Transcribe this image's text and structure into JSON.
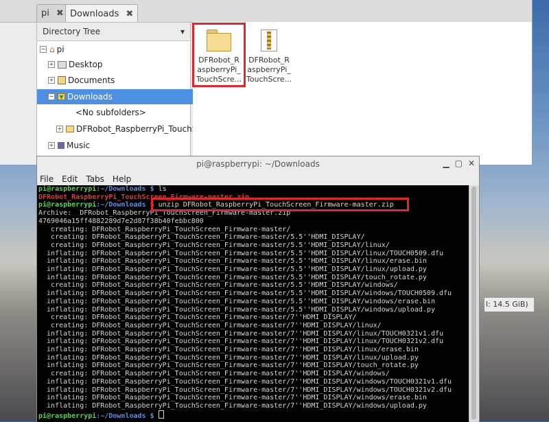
{
  "file_manager": {
    "tabs": [
      {
        "label": "pi",
        "close": "✖"
      },
      {
        "label": "Downloads",
        "close": "✖"
      }
    ],
    "tree_header": "Directory Tree",
    "tree_items": [
      {
        "label": "pi",
        "expander": ""
      },
      {
        "label": "Desktop",
        "expander": "+"
      },
      {
        "label": "Documents",
        "expander": "+"
      },
      {
        "label": "Downloads",
        "expander": "−"
      },
      {
        "label": "<No subfolders>",
        "expander": ""
      },
      {
        "label": "DFRobot_RaspberryPi_TouchSc",
        "expander": "+"
      },
      {
        "label": "Music",
        "expander": "+"
      }
    ],
    "files": [
      {
        "name": "DFRobot_RaspberryPi_TouchScre...",
        "line1": "DFRobot_R",
        "line2": "aspberryPi_",
        "line3": "TouchScre...",
        "icon": "folder-icon"
      },
      {
        "name": "DFRobot_RaspberryPi_TouchScre...",
        "line1": "DFRobot_R",
        "line2": "aspberryPi_",
        "line3": "TouchScre...",
        "icon": "zip-archive-icon"
      }
    ],
    "status_free": "l: 14.5 GiB)"
  },
  "terminal": {
    "title": "pi@raspberrypi: ~/Downloads",
    "menu": [
      "File",
      "Edit",
      "Tabs",
      "Help"
    ],
    "prompt_user": "pi@raspberrypi",
    "prompt_path": ":~/Downloads $",
    "cmd1": " ls",
    "ls_output": "DFRobot_RaspberryPi_TouchScreen_Firmware-master.zip",
    "cmd2": " unzip DFRobot_RaspberryPi_TouchScreen_Firmware-master.zip",
    "archive_line": "Archive:  DFRobot_RaspberryPi_TouchScreen_Firmware-master.zip",
    "hash_line": "4769046a15ff4882289d7e2d87f38b40febbc800",
    "output": [
      "   creating: DFRobot_RaspberryPi_TouchScreen_Firmware-master/",
      "   creating: DFRobot_RaspberryPi_TouchScreen_Firmware-master/5.5''HDMI_DISPLAY/",
      "   creating: DFRobot_RaspberryPi_TouchScreen_Firmware-master/5.5''HDMI_DISPLAY/linux/",
      "  inflating: DFRobot_RaspberryPi_TouchScreen_Firmware-master/5.5''HDMI_DISPLAY/linux/TOUCH0509.dfu",
      "  inflating: DFRobot_RaspberryPi_TouchScreen_Firmware-master/5.5''HDMI_DISPLAY/linux/erase.bin",
      "  inflating: DFRobot_RaspberryPi_TouchScreen_Firmware-master/5.5''HDMI_DISPLAY/linux/upload.py",
      "  inflating: DFRobot_RaspberryPi_TouchScreen_Firmware-master/5.5''HDMI_DISPLAY/touch_rotate.py",
      "   creating: DFRobot_RaspberryPi_TouchScreen_Firmware-master/5.5''HDMI_DISPLAY/windows/",
      "  inflating: DFRobot_RaspberryPi_TouchScreen_Firmware-master/5.5''HDMI_DISPLAY/windows/TOUCH0509.dfu",
      "  inflating: DFRobot_RaspberryPi_TouchScreen_Firmware-master/5.5''HDMI_DISPLAY/windows/erase.bin",
      "  inflating: DFRobot_RaspberryPi_TouchScreen_Firmware-master/5.5''HDMI_DISPLAY/windows/upload.py",
      "   creating: DFRobot_RaspberryPi_TouchScreen_Firmware-master/7''HDMI_DISPLAY/",
      "   creating: DFRobot_RaspberryPi_TouchScreen_Firmware-master/7''HDMI_DISPLAY/linux/",
      "  inflating: DFRobot_RaspberryPi_TouchScreen_Firmware-master/7''HDMI_DISPLAY/linux/TOUCH0321v1.dfu",
      "  inflating: DFRobot_RaspberryPi_TouchScreen_Firmware-master/7''HDMI_DISPLAY/linux/TOUCH0321v2.dfu",
      "  inflating: DFRobot_RaspberryPi_TouchScreen_Firmware-master/7''HDMI_DISPLAY/linux/erase.bin",
      "  inflating: DFRobot_RaspberryPi_TouchScreen_Firmware-master/7''HDMI_DISPLAY/linux/upload.py",
      "  inflating: DFRobot_RaspberryPi_TouchScreen_Firmware-master/7''HDMI_DISPLAY/touch_rotate.py",
      "   creating: DFRobot_RaspberryPi_TouchScreen_Firmware-master/7''HDMI_DISPLAY/windows/",
      "  inflating: DFRobot_RaspberryPi_TouchScreen_Firmware-master/7''HDMI_DISPLAY/windows/TOUCH0321v1.dfu",
      "  inflating: DFRobot_RaspberryPi_TouchScreen_Firmware-master/7''HDMI_DISPLAY/windows/TOUCH0321v2.dfu",
      "  inflating: DFRobot_RaspberryPi_TouchScreen_Firmware-master/7''HDMI_DISPLAY/windows/erase.bin",
      "  inflating: DFRobot_RaspberryPi_TouchScreen_Firmware-master/7''HDMI_DISPLAY/windows/upload.py"
    ]
  },
  "colors": {
    "highlight": "#e0262c",
    "selection": "#4d8fe0",
    "prompt_user": "#5ad25a",
    "prompt_path": "#5b8ee6"
  }
}
